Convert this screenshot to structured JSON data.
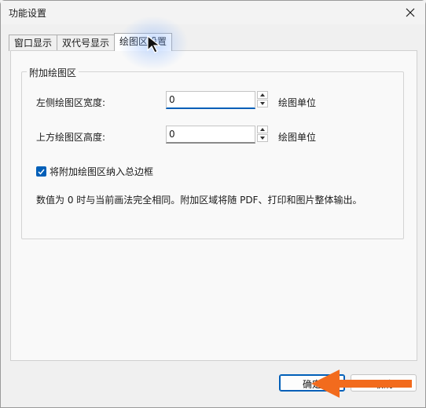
{
  "window": {
    "title": "功能设置"
  },
  "tabs": [
    {
      "label": "窗口显示",
      "active": false
    },
    {
      "label": "双代号显示",
      "active": false
    },
    {
      "label": "绘图区设置",
      "active": true
    }
  ],
  "group": {
    "legend": "附加绘图区",
    "left_width": {
      "label": "左侧绘图区宽度:",
      "value": "0",
      "unit": "绘图单位"
    },
    "top_height": {
      "label": "上方绘图区高度:",
      "value": "0",
      "unit": "绘图单位"
    },
    "include_checkbox": {
      "label": "将附加绘图区纳入总边框",
      "checked": true
    },
    "info_text": "数值为 0 时与当前画法完全相同。附加区域将随 PDF、打印和图片整体输出。"
  },
  "buttons": {
    "ok": "确定",
    "cancel": "取消"
  },
  "colors": {
    "accent": "#005fb8",
    "annotation_arrow": "#f26b1d"
  }
}
